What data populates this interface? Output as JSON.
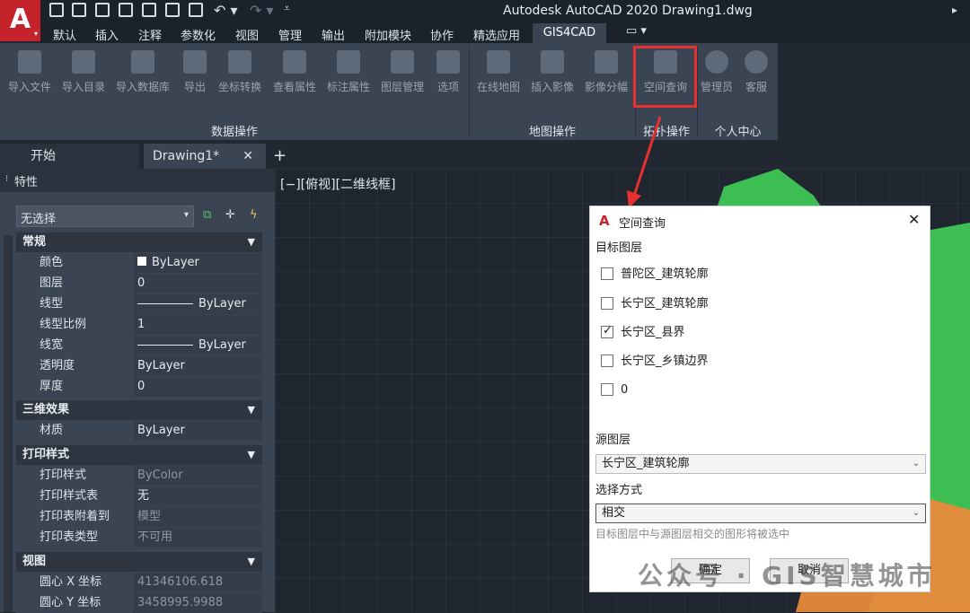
{
  "app": {
    "title": "Autodesk AutoCAD 2020   Drawing1.dwg",
    "logo_letter": "A"
  },
  "ribbon_tabs": [
    "默认",
    "插入",
    "注释",
    "参数化",
    "视图",
    "管理",
    "输出",
    "附加模块",
    "协作",
    "精选应用"
  ],
  "active_ribbon_tab": "GIS4CAD",
  "ribbon": {
    "data_group": {
      "label": "数据操作",
      "buttons": [
        "导入文件",
        "导入目录",
        "导入数据库",
        "导出",
        "坐标转换",
        "查看属性",
        "标注属性",
        "图层管理",
        "选项"
      ]
    },
    "map_group": {
      "label": "地图操作",
      "buttons": [
        "在线地图",
        "插入影像",
        "影像分幅"
      ]
    },
    "topo_group": {
      "label": "拓扑操作",
      "buttons": [
        "空间查询"
      ]
    },
    "personal_group": {
      "label": "个人中心",
      "buttons": [
        "管理员",
        "客服"
      ]
    }
  },
  "doc_tabs": {
    "start": "开始",
    "drawing": "Drawing1*",
    "close": "✕",
    "add": "+"
  },
  "properties": {
    "title": "特性",
    "selection": "无选择",
    "sections": {
      "general": {
        "label": "常规",
        "rows": [
          {
            "k": "颜色",
            "v": "ByLayer"
          },
          {
            "k": "图层",
            "v": "0"
          },
          {
            "k": "线型",
            "v": "ByLayer"
          },
          {
            "k": "线型比例",
            "v": "1"
          },
          {
            "k": "线宽",
            "v": "ByLayer"
          },
          {
            "k": "透明度",
            "v": "ByLayer"
          },
          {
            "k": "厚度",
            "v": "0"
          }
        ]
      },
      "three_d": {
        "label": "三维效果",
        "rows": [
          {
            "k": "材质",
            "v": "ByLayer"
          }
        ]
      },
      "plot": {
        "label": "打印样式",
        "rows": [
          {
            "k": "打印样式",
            "v": "ByColor"
          },
          {
            "k": "打印样式表",
            "v": "无"
          },
          {
            "k": "打印表附着到",
            "v": "模型"
          },
          {
            "k": "打印表类型",
            "v": "不可用"
          }
        ]
      },
      "view": {
        "label": "视图",
        "rows": [
          {
            "k": "圆心 X 坐标",
            "v": "41346106.618"
          },
          {
            "k": "圆心 Y 坐标",
            "v": "3458995.9988"
          }
        ]
      }
    }
  },
  "viewport_label": "[−][俯视][二维线框]",
  "dialog": {
    "title": "空间查询",
    "target_layer_label": "目标图层",
    "layers": [
      {
        "name": "普陀区_建筑轮廓",
        "checked": false
      },
      {
        "name": "长宁区_建筑轮廓",
        "checked": false
      },
      {
        "name": "长宁区_县界",
        "checked": true
      },
      {
        "name": "长宁区_乡镇边界",
        "checked": false
      },
      {
        "name": "0",
        "checked": false
      }
    ],
    "source_layer_label": "源图层",
    "source_layer_value": "长宁区_建筑轮廓",
    "select_mode_label": "选择方式",
    "select_mode_value": "相交",
    "hint": "目标图层中与源图层相交的图形将被选中",
    "ok": "确定",
    "cancel": "取消"
  },
  "watermark": "公众号 · GIS智慧城市",
  "colors": {
    "accent_red": "#e8312f",
    "map_green": "#3fcf58",
    "map_orange": "#e8893c"
  }
}
